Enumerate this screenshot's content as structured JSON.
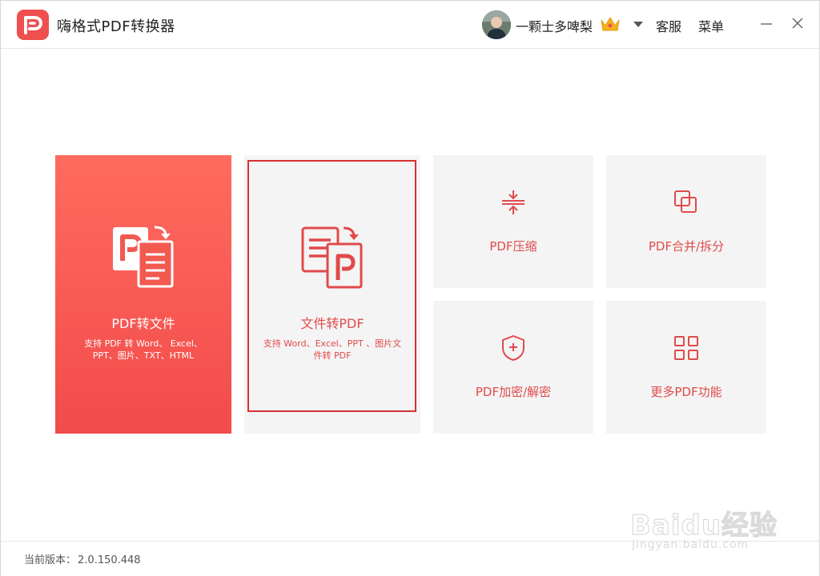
{
  "app": {
    "title": "嗨格式PDF转换器"
  },
  "user": {
    "name": "一颗士多啤梨"
  },
  "toolbar": {
    "service_label": "客服",
    "menu_label": "菜单"
  },
  "cards": {
    "pdf_to_file": {
      "title": "PDF转文件",
      "desc_line1": "支持 PDF 转 Word、 Excel、",
      "desc_line2": "PPT、图片、TXT、HTML"
    },
    "file_to_pdf": {
      "title": "文件转PDF",
      "desc_line1": "支持 Word、Excel、PPT 、图片文",
      "desc_line2": "件转 PDF"
    },
    "compress": {
      "title": "PDF压缩"
    },
    "merge_split": {
      "title": "PDF合并/拆分"
    },
    "encrypt": {
      "title": "PDF加密/解密"
    },
    "more": {
      "title": "更多PDF功能"
    }
  },
  "footer": {
    "version_label": "当前版本：",
    "version": "2.0.150.448"
  },
  "watermark": {
    "brand": "Baidu经验",
    "url": "jingyan.baidu.com"
  },
  "colors": {
    "accent": "#e14a4a",
    "primary_card_top": "#ff6b5e",
    "primary_card_bottom": "#f24b4b",
    "card_bg": "#f4f4f4"
  },
  "icons": {
    "logo": "pdf-p-logo-icon",
    "crown": "crown-icon",
    "dropdown": "caret-down-icon",
    "minimize": "minimize-icon",
    "close": "close-icon",
    "pdf_to_file": "pdf-to-document-icon",
    "file_to_pdf": "document-to-pdf-icon",
    "compress": "compress-icon",
    "merge_split": "merge-squares-icon",
    "encrypt": "shield-plus-icon",
    "more": "grid-icon"
  }
}
